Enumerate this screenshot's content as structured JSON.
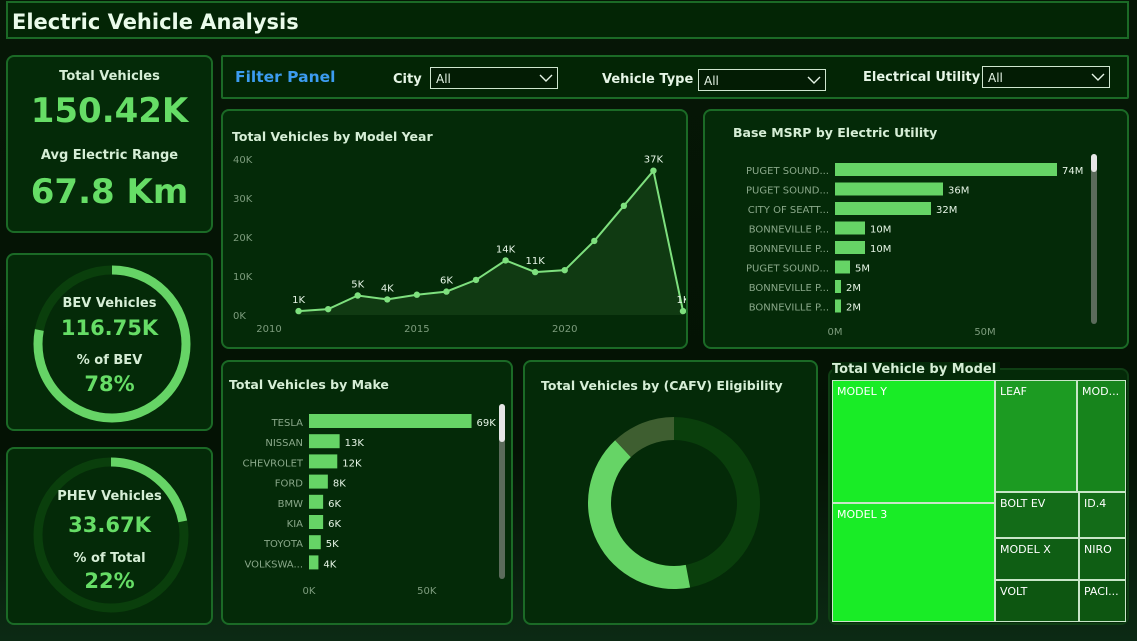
{
  "title": "Electric Vehicle Analysis",
  "kpis": {
    "total_vehicles_label": "Total Vehicles",
    "total_vehicles_value": "150.42K",
    "avg_range_label": "Avg Electric Range",
    "avg_range_value": "67.8 Km",
    "bev_label": "BEV Vehicles",
    "bev_value": "116.75K",
    "bev_pct_label": "% of BEV",
    "bev_pct_value": "78%",
    "bev_fraction": 0.78,
    "phev_label": "PHEV Vehicles",
    "phev_value": "33.67K",
    "phev_pct_label": "% of Total",
    "phev_pct_value": "22%",
    "phev_fraction": 0.22
  },
  "filters": {
    "panel_title": "Filter Panel",
    "city_label": "City",
    "city_value": "All",
    "vehicle_type_label": "Vehicle Type",
    "vehicle_type_value": "All",
    "utility_label": "Electrical Utility",
    "utility_value": "All"
  },
  "colors": {
    "accent": "#66dd66",
    "bright_green": "#19ec26",
    "dark_green": "#0a3f0c",
    "mid_green": "#1b7e1f"
  },
  "chart_data": [
    {
      "id": "model_year",
      "type": "area",
      "title": "Total Vehicles by Model Year",
      "x": [
        2011,
        2012,
        2013,
        2014,
        2015,
        2016,
        2017,
        2018,
        2019,
        2020,
        2021,
        2022,
        2023,
        2024
      ],
      "values": [
        1000,
        1500,
        5000,
        4000,
        5200,
        6000,
        9000,
        14000,
        11000,
        11500,
        19000,
        28000,
        37000,
        1000
      ],
      "data_labels": [
        "1K",
        "",
        "5K",
        "4K",
        "",
        "6K",
        "",
        "14K",
        "11K",
        "",
        "",
        "",
        "37K",
        "1K"
      ],
      "x_ticks": [
        "2010",
        "2015",
        "2020"
      ],
      "y_ticks": [
        "0K",
        "10K",
        "20K",
        "30K",
        "40K"
      ],
      "xlim": [
        2010,
        2024
      ],
      "ylim": [
        0,
        40000
      ]
    },
    {
      "id": "msrp_utility",
      "type": "bar",
      "title": "Base MSRP by Electric Utility",
      "categories": [
        "PUGET SOUND...",
        "PUGET SOUND...",
        "CITY OF SEATT...",
        "BONNEVILLE P...",
        "BONNEVILLE P...",
        "PUGET SOUND...",
        "BONNEVILLE P...",
        "BONNEVILLE P..."
      ],
      "values": [
        74,
        36,
        32,
        10,
        10,
        5,
        2,
        2
      ],
      "data_labels": [
        "74M",
        "36M",
        "32M",
        "10M",
        "10M",
        "5M",
        "2M",
        "2M"
      ],
      "x_ticks": [
        "0M",
        "50M"
      ],
      "xlim": [
        0,
        80
      ]
    },
    {
      "id": "by_make",
      "type": "bar",
      "title": "Total Vehicles by Make",
      "categories": [
        "TESLA",
        "NISSAN",
        "CHEVROLET",
        "FORD",
        "BMW",
        "KIA",
        "TOYOTA",
        "VOLKSWA..."
      ],
      "values": [
        69,
        13,
        12,
        8,
        6,
        6,
        5,
        4
      ],
      "data_labels": [
        "69K",
        "13K",
        "12K",
        "8K",
        "6K",
        "6K",
        "5K",
        "4K"
      ],
      "x_ticks": [
        "0K",
        "50K"
      ],
      "xlim": [
        0,
        90
      ]
    },
    {
      "id": "cafv",
      "type": "pie",
      "title": "Total Vehicles by (CAFV) Eligibility",
      "values": [
        47,
        41,
        12
      ],
      "colors": [
        "#0a3f0c",
        "#66d466",
        "#3e5e30"
      ]
    },
    {
      "id": "by_model",
      "type": "heatmap",
      "title": "Total Vehicle by Model",
      "categories": [
        "MODEL Y",
        "MODEL 3",
        "LEAF",
        "MOD...",
        "BOLT EV",
        "ID.4",
        "MODEL X",
        "NIRO",
        "VOLT",
        "PACI..."
      ]
    }
  ]
}
